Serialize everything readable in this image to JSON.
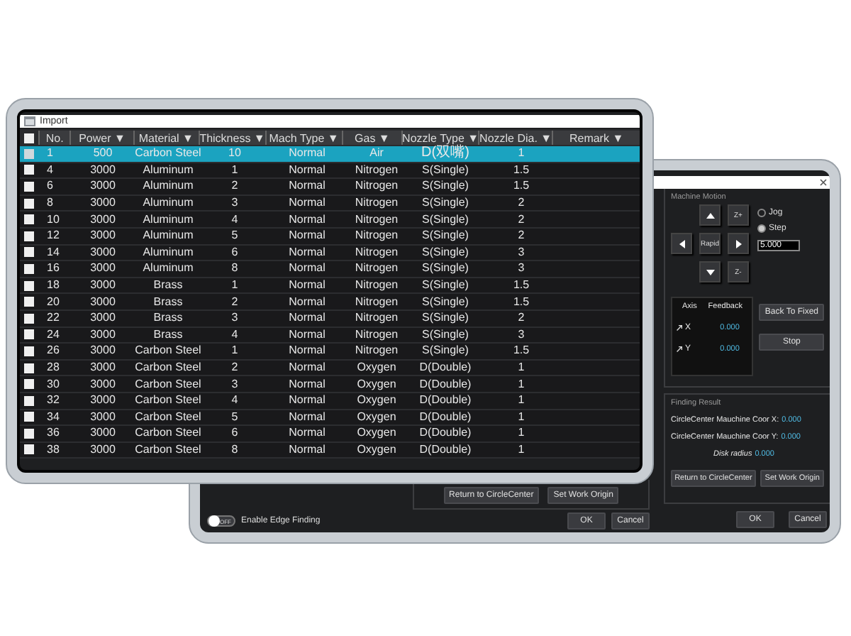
{
  "import_window": {
    "title": "Import",
    "header_checked": false,
    "columns": [
      "No.",
      "Power ▼",
      "Material ▼",
      "Thickness ▼",
      "Mach Type ▼",
      "Gas ▼",
      "Nozzle Type ▼",
      "Nozzle Dia. ▼",
      "Remark ▼"
    ],
    "rows": [
      {
        "selected": true,
        "checked": false,
        "cells": [
          "1",
          "500",
          "Carbon Steel",
          "10",
          "Normal",
          "Air",
          "D(双嘴)",
          "1"
        ]
      },
      {
        "selected": false,
        "checked": false,
        "cells": [
          "4",
          "3000",
          "Aluminum",
          "1",
          "Normal",
          "Nitrogen",
          "S(Single)",
          "1.5"
        ]
      },
      {
        "selected": false,
        "checked": false,
        "cells": [
          "6",
          "3000",
          "Aluminum",
          "2",
          "Normal",
          "Nitrogen",
          "S(Single)",
          "1.5"
        ]
      },
      {
        "selected": false,
        "checked": false,
        "cells": [
          "8",
          "3000",
          "Aluminum",
          "3",
          "Normal",
          "Nitrogen",
          "S(Single)",
          "2"
        ]
      },
      {
        "selected": false,
        "checked": false,
        "cells": [
          "10",
          "3000",
          "Aluminum",
          "4",
          "Normal",
          "Nitrogen",
          "S(Single)",
          "2"
        ]
      },
      {
        "selected": false,
        "checked": false,
        "cells": [
          "12",
          "3000",
          "Aluminum",
          "5",
          "Normal",
          "Nitrogen",
          "S(Single)",
          "2"
        ]
      },
      {
        "selected": false,
        "checked": false,
        "cells": [
          "14",
          "3000",
          "Aluminum",
          "6",
          "Normal",
          "Nitrogen",
          "S(Single)",
          "3"
        ]
      },
      {
        "selected": false,
        "checked": false,
        "cells": [
          "16",
          "3000",
          "Aluminum",
          "8",
          "Normal",
          "Nitrogen",
          "S(Single)",
          "3"
        ]
      },
      {
        "selected": false,
        "checked": false,
        "cells": [
          "18",
          "3000",
          "Brass",
          "1",
          "Normal",
          "Nitrogen",
          "S(Single)",
          "1.5"
        ]
      },
      {
        "selected": false,
        "checked": false,
        "cells": [
          "20",
          "3000",
          "Brass",
          "2",
          "Normal",
          "Nitrogen",
          "S(Single)",
          "1.5"
        ]
      },
      {
        "selected": false,
        "checked": false,
        "cells": [
          "22",
          "3000",
          "Brass",
          "3",
          "Normal",
          "Nitrogen",
          "S(Single)",
          "2"
        ]
      },
      {
        "selected": false,
        "checked": false,
        "cells": [
          "24",
          "3000",
          "Brass",
          "4",
          "Normal",
          "Nitrogen",
          "S(Single)",
          "3"
        ]
      },
      {
        "selected": false,
        "checked": false,
        "cells": [
          "26",
          "3000",
          "Carbon Steel",
          "1",
          "Normal",
          "Nitrogen",
          "S(Single)",
          "1.5"
        ]
      },
      {
        "selected": false,
        "checked": false,
        "cells": [
          "28",
          "3000",
          "Carbon Steel",
          "2",
          "Normal",
          "Oxygen",
          "D(Double)",
          "1"
        ]
      },
      {
        "selected": false,
        "checked": false,
        "cells": [
          "30",
          "3000",
          "Carbon Steel",
          "3",
          "Normal",
          "Oxygen",
          "D(Double)",
          "1"
        ]
      },
      {
        "selected": false,
        "checked": false,
        "cells": [
          "32",
          "3000",
          "Carbon Steel",
          "4",
          "Normal",
          "Oxygen",
          "D(Double)",
          "1"
        ]
      },
      {
        "selected": false,
        "checked": false,
        "cells": [
          "34",
          "3000",
          "Carbon Steel",
          "5",
          "Normal",
          "Oxygen",
          "D(Double)",
          "1"
        ]
      },
      {
        "selected": false,
        "checked": false,
        "cells": [
          "36",
          "3000",
          "Carbon Steel",
          "6",
          "Normal",
          "Oxygen",
          "D(Double)",
          "1"
        ]
      },
      {
        "selected": false,
        "checked": false,
        "cells": [
          "38",
          "3000",
          "Carbon Steel",
          "8",
          "Normal",
          "Oxygen",
          "D(Double)",
          "1"
        ]
      }
    ]
  },
  "edge_finding_window": {
    "left_buttons": [
      "Return to CircleCenter",
      "Set Work Origin"
    ],
    "edge_toggle": {
      "on": false,
      "label": "OFF",
      "text": "Enable Edge Finding"
    },
    "left_footer_buttons": [
      "OK",
      "Cancel"
    ],
    "machine_motion": {
      "title": "Machine Motion",
      "z_up": "Z+",
      "rapid": "Rapid",
      "z_down": "Z-",
      "modes": [
        {
          "label": "Jog",
          "selected": false
        },
        {
          "label": "Step",
          "selected": true
        }
      ],
      "step_value": "5.000",
      "axis_header": "Axis",
      "feedback_header": "Feedback",
      "axes": [
        {
          "name": "X",
          "value": "0.000"
        },
        {
          "name": "Y",
          "value": "0.000"
        }
      ],
      "buttons": [
        "Back To Fixed",
        "Stop"
      ]
    },
    "finding_result": {
      "title": "Finding Result",
      "lines": [
        {
          "label": "CircleCenter Mauchine Coor X:",
          "value": "0.000"
        },
        {
          "label": "CircleCenter Mauchine Coor Y:",
          "value": "0.000"
        },
        {
          "label": "Disk radius",
          "value": "0.000"
        }
      ],
      "buttons": [
        "Return to CircleCenter",
        "Set Work Origin"
      ]
    },
    "footer_buttons": [
      "OK",
      "Cancel"
    ]
  }
}
